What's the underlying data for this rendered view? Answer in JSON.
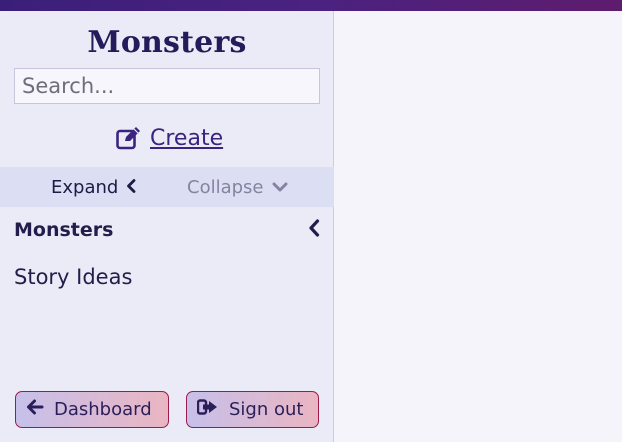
{
  "app": {
    "title": "Monsters"
  },
  "search": {
    "placeholder": "Search..."
  },
  "toolbar": {
    "create_label": "Create"
  },
  "tree_controls": {
    "expand_label": "Expand",
    "collapse_label": "Collapse"
  },
  "nav": {
    "items": [
      {
        "label": "Monsters",
        "active": true
      },
      {
        "label": "Story Ideas",
        "active": false
      }
    ]
  },
  "footer": {
    "dashboard_label": "Dashboard",
    "signout_label": "Sign out"
  },
  "colors": {
    "accent": "#3b2480",
    "topbar": "#4a2280",
    "sidebar_bg": "#eaebf6",
    "main_bg": "#f6f4fb",
    "button_border": "#9b1b4a"
  },
  "icons": {
    "create": "edit-icon",
    "expand": "chevron-left-icon",
    "collapse": "chevron-down-icon",
    "dashboard": "arrow-left-icon",
    "signout": "sign-out-icon"
  }
}
